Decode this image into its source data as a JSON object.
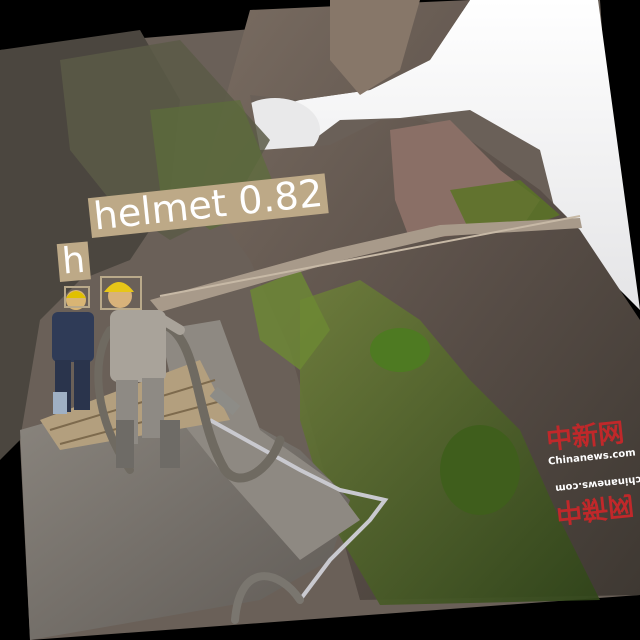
{
  "image": {
    "description_free": true
  },
  "detections": [
    {
      "label_text": "helmet 0.82",
      "class": "helmet",
      "score": 0.82,
      "color": "#bda987"
    },
    {
      "label_text": "h",
      "class": "helmet",
      "color": "#bda987"
    }
  ],
  "watermark": {
    "brand_top": "中新网",
    "site_top": "Chinanews.com",
    "site_bottom": "chinanews.com",
    "brand_bottom": "中新网",
    "color": "#c0282a"
  },
  "colors": {
    "sky": "#f1f1f3",
    "rock": "#6a5d54",
    "vegetation": "#4f6a2a",
    "concrete": "#77736e",
    "box": "#bda987"
  }
}
